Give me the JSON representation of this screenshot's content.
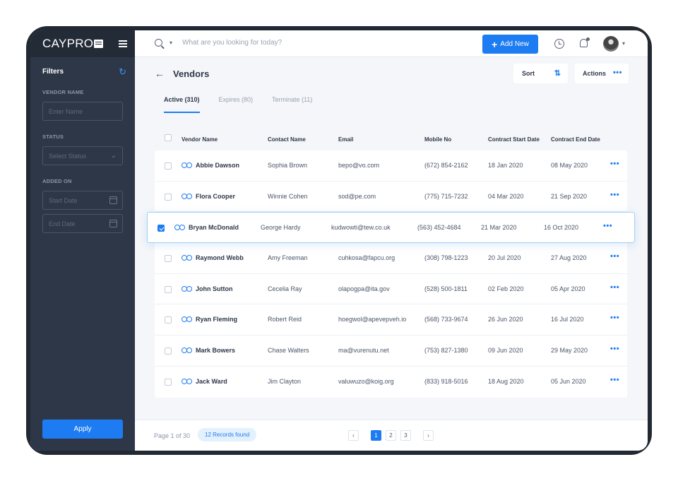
{
  "brand": {
    "name": "CAYPRO"
  },
  "sidebar": {
    "filters_title": "Filters",
    "vendor_name_label": "VENDOR NAME",
    "vendor_name_placeholder": "Enter Name",
    "status_label": "STATUS",
    "status_placeholder": "Select Status",
    "added_on_label": "ADDED ON",
    "start_date_placeholder": "Start Date",
    "end_date_placeholder": "End Date",
    "apply_label": "Apply"
  },
  "topbar": {
    "search_placeholder": "What are you looking for today?",
    "add_new_label": "Add New"
  },
  "page": {
    "title": "Vendors",
    "sort_label": "Sort",
    "actions_label": "Actions"
  },
  "tabs": [
    {
      "label": "Active (310)"
    },
    {
      "label": "Expires (80)"
    },
    {
      "label": "Terminate (11)"
    }
  ],
  "table": {
    "headers": {
      "vendor_name": "Vendor Name",
      "contact_name": "Contact Name",
      "email": "Email",
      "mobile": "Mobile No",
      "start": "Contract Start Date",
      "end": "Contract End Date"
    },
    "rows": [
      {
        "vendor": "Abbie Dawson",
        "contact": "Sophia Brown",
        "email": "bepo@vo.com",
        "mobile": "(672) 854-2162",
        "start": "18 Jan 2020",
        "end": "08 May 2020",
        "selected": false
      },
      {
        "vendor": "Flora Cooper",
        "contact": "Winnie Cohen",
        "email": "sod@pe.com",
        "mobile": "(775) 715-7232",
        "start": "04 Mar 2020",
        "end": "21 Sep 2020",
        "selected": false
      },
      {
        "vendor": "Bryan McDonald",
        "contact": "George Hardy",
        "email": "kudwowti@tew.co.uk",
        "mobile": "(563) 452-4684",
        "start": "21 Mar 2020",
        "end": "16 Oct 2020",
        "selected": true
      },
      {
        "vendor": "Raymond Webb",
        "contact": "Amy Freeman",
        "email": "cuhkosa@fapcu.org",
        "mobile": "(308) 798-1223",
        "start": "20 Jul 2020",
        "end": "27 Aug 2020",
        "selected": false
      },
      {
        "vendor": "John Sutton",
        "contact": "Cecelia Ray",
        "email": "olapogpa@ita.gov",
        "mobile": "(528) 500-1811",
        "start": "02 Feb 2020",
        "end": "05 Apr 2020",
        "selected": false
      },
      {
        "vendor": "Ryan Fleming",
        "contact": "Robert Reid",
        "email": "hoegwol@apevepveh.io",
        "mobile": "(568) 733-9674",
        "start": "26 Jun 2020",
        "end": "16 Jul 2020",
        "selected": false
      },
      {
        "vendor": "Mark Bowers",
        "contact": "Chase Walters",
        "email": "ma@vurenutu.net",
        "mobile": "(753) 827-1380",
        "start": "09 Jun 2020",
        "end": "29 May 2020",
        "selected": false
      },
      {
        "vendor": "Jack Ward",
        "contact": "Jim Clayton",
        "email": "valuwuzo@koig.org",
        "mobile": "(833) 918-5016",
        "start": "18 Aug 2020",
        "end": "05 Jun 2020",
        "selected": false
      }
    ]
  },
  "footer": {
    "page_of": "Page 1 of 30",
    "records": "12 Records found",
    "pages": [
      "1",
      "2",
      "3"
    ],
    "prev": "‹",
    "next": "›"
  }
}
